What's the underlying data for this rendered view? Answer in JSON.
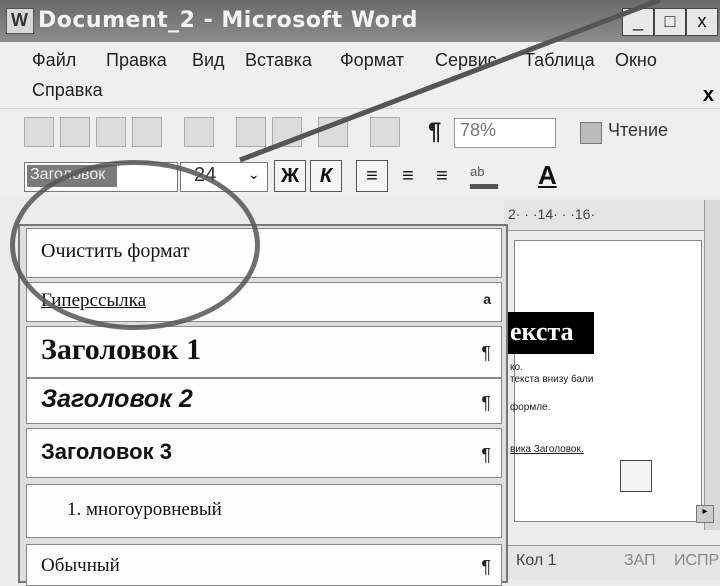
{
  "window": {
    "title": "Document_2 - Microsoft Word",
    "min_label": "_",
    "max_label": "□",
    "close_label": "x"
  },
  "menu": {
    "items": [
      "Файл",
      "Правка",
      "Вид",
      "Вставка",
      "Формат",
      "Сервис",
      "Таблица",
      "Окно"
    ],
    "help": "Справка",
    "close_doc": "x"
  },
  "toolbar": {
    "pilcrow": "¶",
    "zoom": "78%",
    "read_label": "Чтение",
    "style_value": "Заголовок",
    "font_size": "24",
    "bold_label": "Ж",
    "italic_label": "К",
    "font_color_label": "A"
  },
  "style_dropdown": {
    "items": [
      {
        "label": "Очистить формат",
        "mark": ""
      },
      {
        "label": "Гиперссылка",
        "mark": "a"
      },
      {
        "label": "Заголовок 1",
        "mark": "¶"
      },
      {
        "label": "Заголовок 2",
        "mark": "¶"
      },
      {
        "label": "Заголовок 3",
        "mark": "¶"
      },
      {
        "label": "1. многоуровневый",
        "mark": ""
      },
      {
        "label": "Обычный",
        "mark": "¶"
      }
    ]
  },
  "document": {
    "ruler_text": "2· · ·14· · ·16·",
    "heading_fragment": "екста",
    "line1": "ко.",
    "line2": "текста внизу бали",
    "line3": "формле.",
    "link_fragment": "вика Заголовок."
  },
  "status": {
    "column": "Кол 1",
    "rec": "ЗАП",
    "ispr": "ИСПР"
  }
}
